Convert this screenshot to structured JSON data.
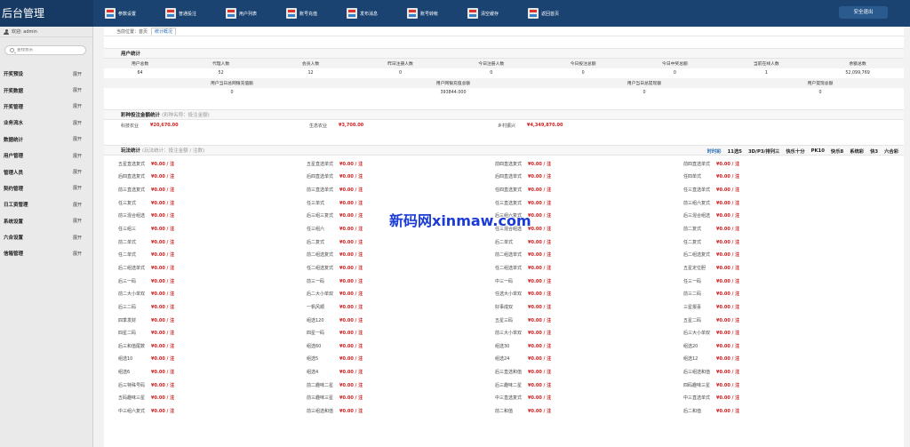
{
  "brand": "后台管理",
  "topnav": [
    "参数设置",
    "普通投注",
    "用户列表",
    "账号充值",
    "发布消息",
    "账号转帐",
    "清空缓存",
    "返回首页"
  ],
  "logout_label": "安全退出",
  "sidebar": {
    "welcome": "欢迎: admin",
    "search_placeholder": "查找会员",
    "expand_label": "展开",
    "items": [
      "开奖预设",
      "开奖数据",
      "开奖管理",
      "业务流水",
      "数据统计",
      "用户管理",
      "管理人员",
      "契约管理",
      "日工资管理",
      "系统设置",
      "六合设置",
      "信箱管理"
    ]
  },
  "breadcrumb": {
    "location": "当前位置：首页",
    "tab": "统计概况"
  },
  "user_stats": {
    "title": "用户统计",
    "headers1": [
      "用户总数",
      "代理人数",
      "会员人数",
      "昨日注册人数",
      "今日注册人数",
      "今日投注总额",
      "今日中奖总额",
      "当前在线人数",
      "余额总数"
    ],
    "values1": [
      "64",
      "52",
      "12",
      "0",
      "0",
      "0",
      "0",
      "1",
      "52,099,769"
    ],
    "headers2": [
      "用户当日总网银充值额",
      "用户网银充值总额",
      "用户当日总提现额",
      "用户提现总额"
    ],
    "values2": [
      "0",
      "393844.000",
      "0",
      "0"
    ]
  },
  "lottery_stats": {
    "title": "彩种投注金额统计",
    "subtitle": "(彩种名称：投注金额)",
    "items": [
      {
        "name": "科技农业",
        "value": "¥20,670.00"
      },
      {
        "name": "生态农业",
        "value": "¥3,700.00"
      },
      {
        "name": "乡村振兴",
        "value": "¥4,349,870.00"
      }
    ]
  },
  "play_stats": {
    "title": "玩法统计",
    "subtitle": "(玩法统计：投注金额 / 注数)",
    "tabs": [
      "时时彩",
      "11选5",
      "3D/P3/排列三",
      "快乐十分",
      "PK10",
      "快乐8",
      "系统彩",
      "快3",
      "六合彩"
    ],
    "value": "¥0.00 / 注",
    "rows": [
      [
        "五星直选复式",
        "五星直选单式",
        "前四直选复式",
        "前四直选单式"
      ],
      [
        "后四直选复式",
        "后四直选单式",
        "后四直选单式",
        "任四单式"
      ],
      [
        "前三直选复式",
        "前三直选单式",
        "任四直选复式",
        "任三直选单式"
      ],
      [
        "任三复式",
        "任三单式",
        "任三直选复式",
        "前三组六复式"
      ],
      [
        "前三混合组选",
        "后三组三复式",
        "后三组六复式",
        "后三混合组选"
      ],
      [
        "任三组三",
        "任三组六",
        "任三混合组选",
        "前二复式"
      ],
      [
        "前二单式",
        "后二复式",
        "后二单式",
        "任二复式"
      ],
      [
        "任二单式",
        "前二组选复式",
        "前二组选单式",
        "后二组选复式"
      ],
      [
        "后二组选单式",
        "任二组选复式",
        "任二组选单式",
        "五星定位胆"
      ],
      [
        "后三一码",
        "前三一码",
        "中三一码",
        "任三一码"
      ],
      [
        "前二大小单双",
        "后二大小单双",
        "任选大小单双",
        "前三二码"
      ],
      [
        "后三二码",
        "一帆风顺",
        "好事成双",
        "三星报喜"
      ],
      [
        "四季发财",
        "组选120",
        "五星三码",
        "五星二码"
      ],
      [
        "四星二码",
        "四星一码",
        "前三大小单双",
        "后三大小单双"
      ],
      [
        "后三和值尾数",
        "组选60",
        "组选30",
        "组选20"
      ],
      [
        "组选10",
        "组选5",
        "组选24",
        "组选12"
      ],
      [
        "组选6",
        "组选4",
        "后三直选和值",
        "后三组选和值"
      ],
      [
        "后三特殊号码",
        "前二趣味二星",
        "后三趣味二星",
        "四码趣味三星"
      ],
      [
        "五码趣味三星",
        "前三趣味三星",
        "中三直选复式",
        "中三直选单式"
      ],
      [
        "中三组六复式",
        "前三组选和值",
        "前二和值",
        "后二和值"
      ]
    ]
  },
  "watermark": "新码网xinmaw.com"
}
